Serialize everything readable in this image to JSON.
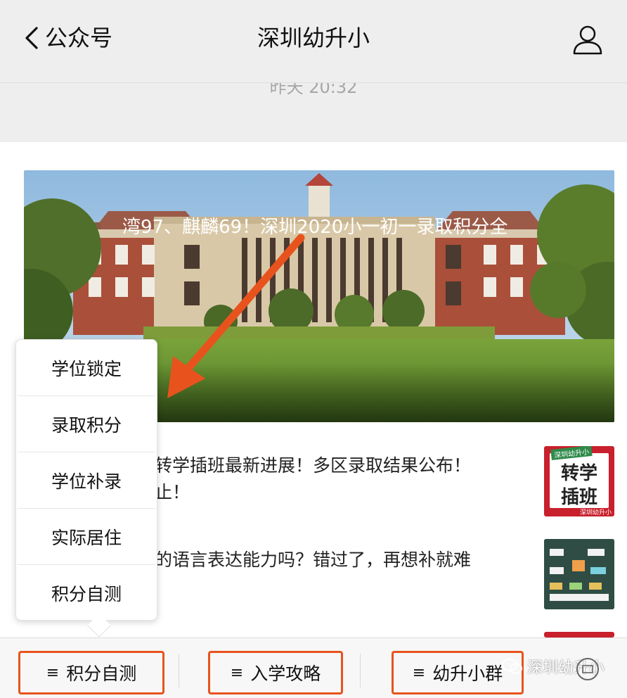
{
  "header": {
    "back_label": "公众号",
    "title": "深圳幼升小"
  },
  "strip": {
    "time": "昨天 20:32"
  },
  "hero": {
    "title": "湾97、麒麟69！深圳2020小一初一录取积分全"
  },
  "items": [
    {
      "title_line1": "转学插班最新进展！多区录取结果公布！",
      "title_line2": "止！",
      "thumb_line1": "转学",
      "thumb_line2": "插班",
      "thumb_tag": "深圳幼升小",
      "thumb_footer": "深圳幼升小"
    },
    {
      "title_line1": "的语言表达能力吗？错过了，再想补就难",
      "title_line2": ""
    }
  ],
  "popup": {
    "items": [
      "学位锁定",
      "录取积分",
      "学位补录",
      "实际居住",
      "积分自测"
    ]
  },
  "bottombar": {
    "tabs": [
      {
        "icon": "≡",
        "label": "积分自测"
      },
      {
        "icon": "≡",
        "label": "入学攻略"
      },
      {
        "icon": "≡",
        "label": "幼升小群"
      }
    ],
    "watermark": "深圳幼升小"
  },
  "colors": {
    "accent": "#e8531d",
    "header_bg": "#eeeeee",
    "thumb_red": "#c8202c"
  }
}
